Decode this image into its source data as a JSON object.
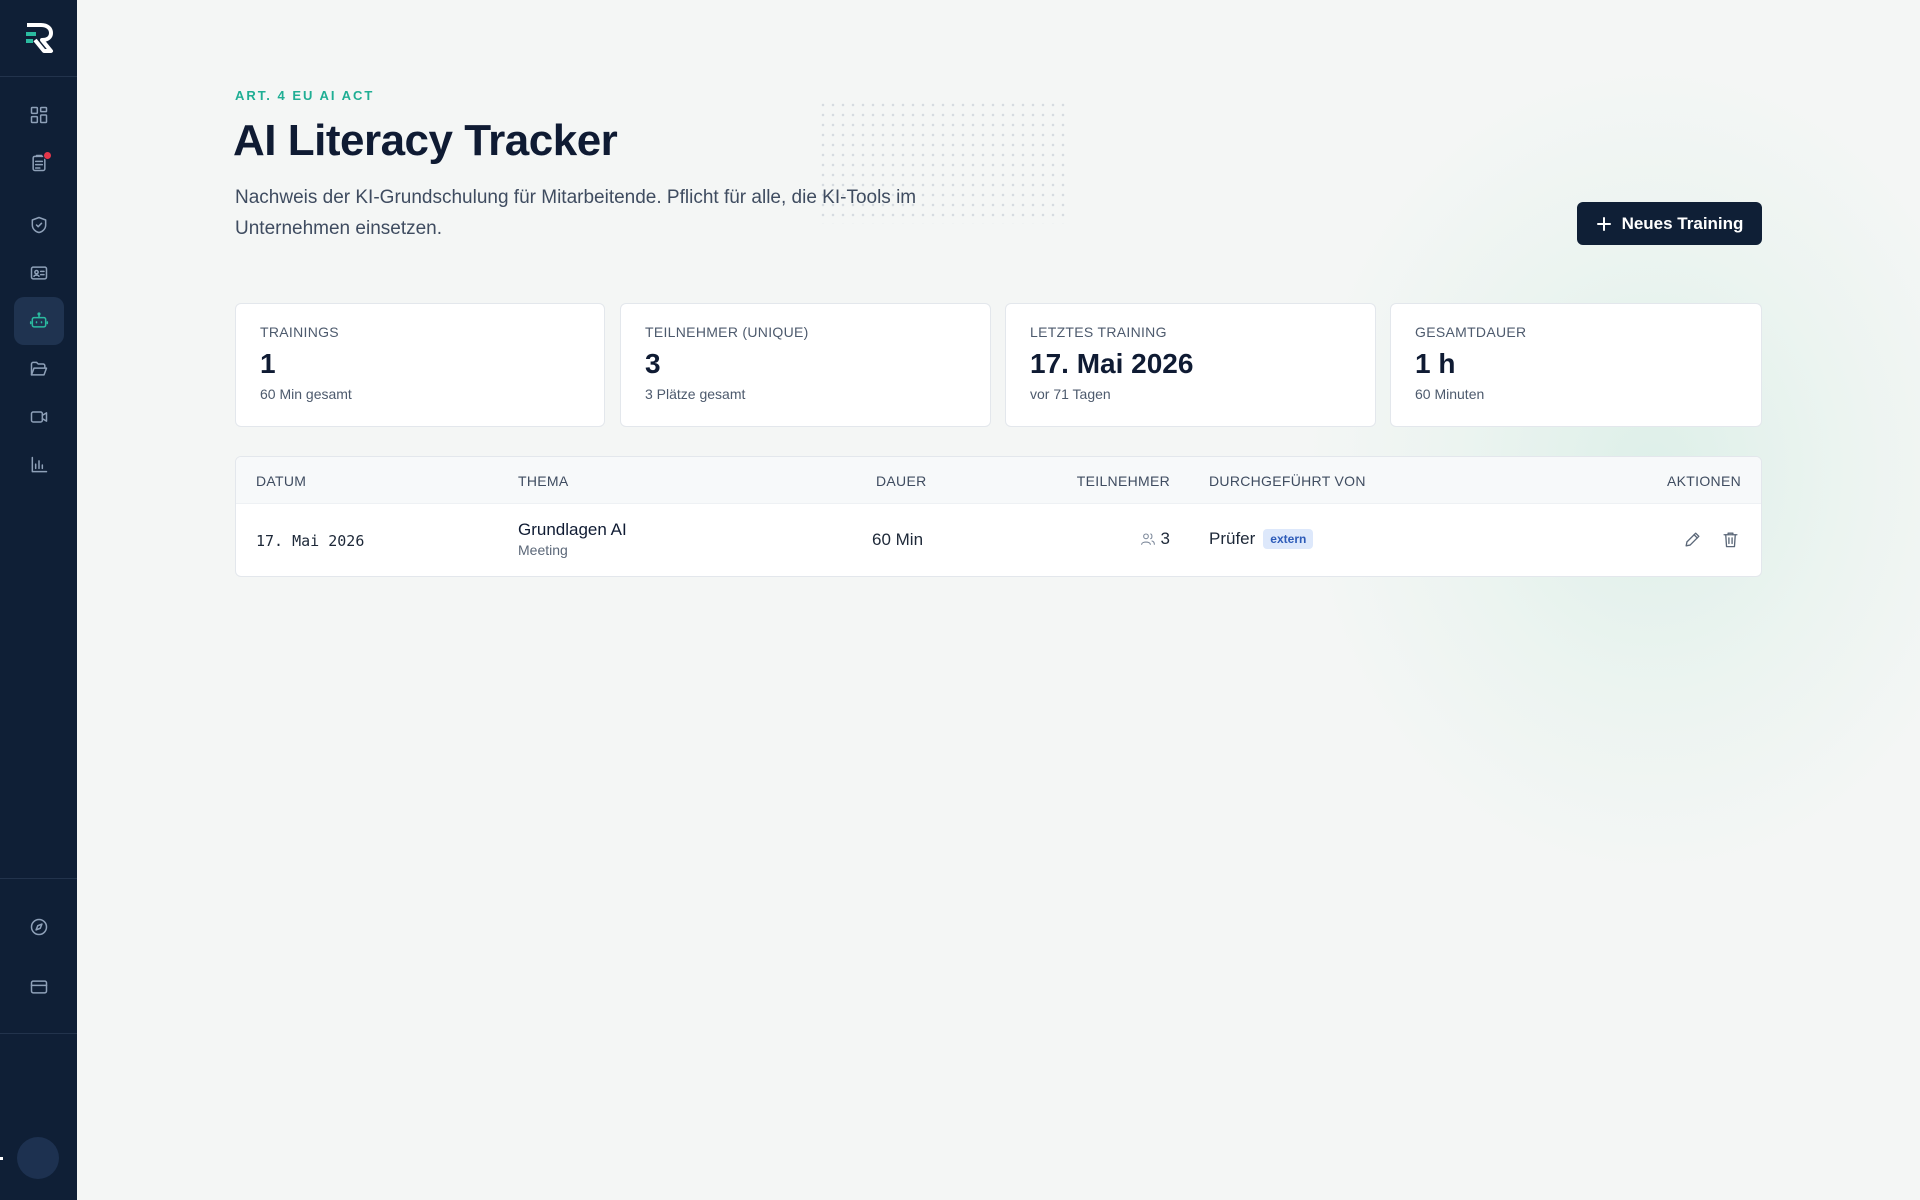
{
  "sidebar": {
    "logo": "R",
    "nav_items": [
      {
        "icon": "dashboard-icon"
      },
      {
        "icon": "clipboard-list-icon",
        "notification": true
      },
      {
        "icon": "shield-check-icon"
      },
      {
        "icon": "id-card-icon"
      },
      {
        "icon": "robot-icon",
        "active": true
      },
      {
        "icon": "folder-open-icon"
      },
      {
        "icon": "video-icon"
      },
      {
        "icon": "bar-chart-icon"
      }
    ],
    "bottom_items": [
      {
        "icon": "compass-icon"
      },
      {
        "icon": "credit-card-icon"
      }
    ]
  },
  "header": {
    "eyebrow": "ART. 4 EU AI ACT",
    "title": "AI Literacy Tracker",
    "subtitle": "Nachweis der KI-Grundschulung für Mitarbeitende. Pflicht für alle, die KI-Tools im Unternehmen einsetzen.",
    "new_button_label": "Neues Training"
  },
  "stats": [
    {
      "label": "TRAININGS",
      "value": "1",
      "sub": "60 Min gesamt"
    },
    {
      "label": "TEILNEHMER (UNIQUE)",
      "value": "3",
      "sub": "3 Plätze gesamt"
    },
    {
      "label": "LETZTES TRAINING",
      "value": "17. Mai 2026",
      "sub": "vor 71 Tagen"
    },
    {
      "label": "GESAMTDAUER",
      "value": "1 h",
      "sub": "60 Minuten"
    }
  ],
  "table": {
    "columns": [
      "DATUM",
      "THEMA",
      "DAUER",
      "TEILNEHMER",
      "DURCHGEFÜHRT VON",
      "AKTIONEN"
    ],
    "rows": [
      {
        "date": "17. Mai 2026",
        "topic": "Grundlagen AI",
        "topic_type": "Meeting",
        "duration": "60 Min",
        "participants": "3",
        "conducted_by": "Prüfer",
        "conducted_badge": "extern"
      }
    ]
  },
  "colors": {
    "sidebar_bg": "#0f1f36",
    "accent": "#1fae94",
    "primary_button": "#0f1f36",
    "notification": "#e5374b",
    "badge_bg": "#dde8fb",
    "badge_text": "#2d5bb8"
  }
}
